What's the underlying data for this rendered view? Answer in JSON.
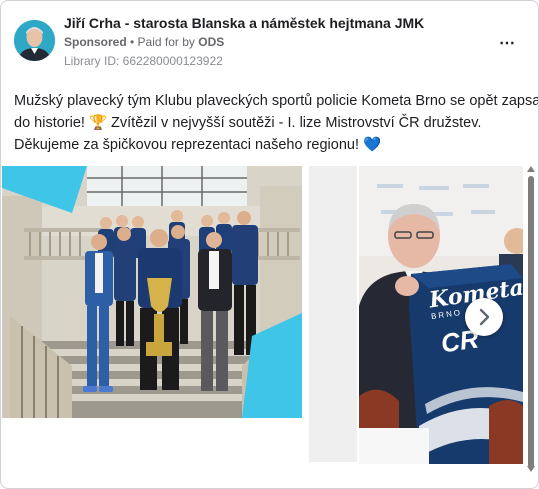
{
  "post": {
    "author": "Jiří Crha - starosta Blanska a náměstek hejtmana JMK",
    "sponsored": "Sponsored",
    "separator": " • ",
    "paid_for_prefix": "Paid for by ",
    "paid_for_name": "ODS",
    "library_id": "Library ID: 662280000123922",
    "more_icon": "⋯",
    "text_lines": [
      "Mužský plavecký tým Klubu plaveckých sportů policie Kometa Brno se opět zapsal",
      "do historie! 🏆 Zvítězil v nejvyšší soutěži - I. lize Mistrovství ČR družstev.",
      "Děkujeme za špičkovou reprezentaci našeho regionu! 💙"
    ]
  },
  "carousel": {
    "shirt_brand": "Kometa",
    "shirt_sub": "BRNO",
    "shirt_letters": "CR",
    "next_icon": "chevron-right-icon"
  },
  "colors": {
    "accent_cyan": "#3ec5e8",
    "shirt_navy": "#163a6b",
    "text_primary": "#1c1e21",
    "text_secondary": "#65676b",
    "card_border": "#cfd2d6",
    "scrollbar": "#7d7d7d"
  }
}
